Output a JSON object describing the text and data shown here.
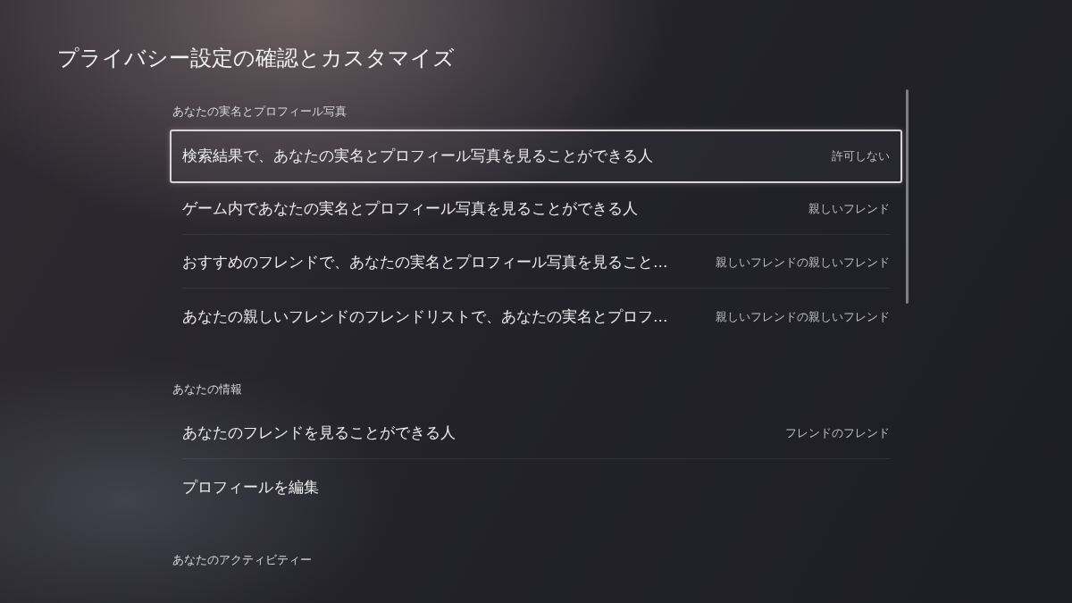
{
  "title": "プライバシー設定の確認とカスタマイズ",
  "sections": [
    {
      "heading": "あなたの実名とプロフィール写真",
      "items": [
        {
          "label": "検索結果で、あなたの実名とプロフィール写真を見ることができる人",
          "value": "許可しない",
          "selected": true
        },
        {
          "label": "ゲーム内であなたの実名とプロフィール写真を見ることができる人",
          "value": "親しいフレンド",
          "selected": false
        },
        {
          "label": "おすすめのフレンドで、あなたの実名とプロフィール写真を見ること…",
          "value": "親しいフレンドの親しいフレンド",
          "selected": false
        },
        {
          "label": "あなたの親しいフレンドのフレンドリストで、あなたの実名とプロフ…",
          "value": "親しいフレンドの親しいフレンド",
          "selected": false
        }
      ]
    },
    {
      "heading": "あなたの情報",
      "items": [
        {
          "label": "あなたのフレンドを見ることができる人",
          "value": "フレンドのフレンド",
          "selected": false
        },
        {
          "label": "プロフィールを編集",
          "selected": false
        }
      ]
    },
    {
      "heading": "あなたのアクティビティー"
    }
  ]
}
